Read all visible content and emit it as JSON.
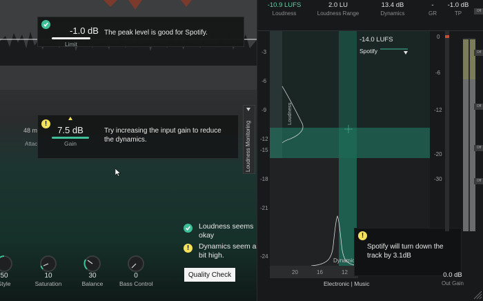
{
  "limit_popup": {
    "value": "-1.0 dB",
    "label": "Limit",
    "message": "The peak level is good for Spotify."
  },
  "gain_popup": {
    "value": "7.5 dB",
    "label": "Gain",
    "message": "Try increasing the input gain to reduce the dynamics."
  },
  "partial_labels": {
    "attack_value": "48 m",
    "attack_label": "Attac"
  },
  "status": [
    {
      "type": "ok",
      "text": "Loudness seems okay"
    },
    {
      "type": "warn",
      "text": "Dynamics seem a bit high."
    }
  ],
  "quality_check_label": "Quality Check",
  "loudness_monitoring_tab": "Loudness Monitoring",
  "knobs": [
    {
      "value": "50",
      "label": "Style",
      "level": 0.5
    },
    {
      "value": "10",
      "label": "Saturation",
      "level": 0.1
    },
    {
      "value": "30",
      "label": "Balance",
      "level": 0.3
    },
    {
      "value": "0",
      "label": "Bass Control",
      "level": 0.0
    }
  ],
  "metrics": [
    {
      "value": "-10.9 LUFS",
      "label": "Loudness",
      "accent": true
    },
    {
      "value": "2.0 LU",
      "label": "Loudness Range",
      "accent": false
    },
    {
      "value": "13.4 dB",
      "label": "Dynamics",
      "accent": false
    },
    {
      "value": "-",
      "label": "GR",
      "accent": false
    },
    {
      "value": "-1.0 dB",
      "label": "TP",
      "accent": false
    }
  ],
  "plot": {
    "y_ticks": [
      "-3",
      "-6",
      "-9",
      "-12",
      "-15",
      "-18",
      "-21",
      "-24"
    ],
    "x_ticks": [
      "20",
      "16",
      "12"
    ],
    "loudness_axis_label": "Loudness",
    "dynamics_axis_label": "Dynamic",
    "target_value": "-14.0 LUFS",
    "target_profile": "Spotify",
    "genre": "Electronic | Music"
  },
  "spotify_popup": {
    "message": "Spotify will turn down the track by 3.1dB"
  },
  "meter_ticks": [
    "0",
    "-6",
    "-12",
    "-20",
    "-30"
  ],
  "out_gain": {
    "value": "0.0 dB",
    "label": "Out Gain"
  },
  "side_buttons": [
    "Off",
    "Off",
    "Off",
    "Off",
    "Off"
  ],
  "colors": {
    "accent": "#3fbf98",
    "warn": "#f4e35a",
    "metric_accent": "#5fd2a6"
  }
}
